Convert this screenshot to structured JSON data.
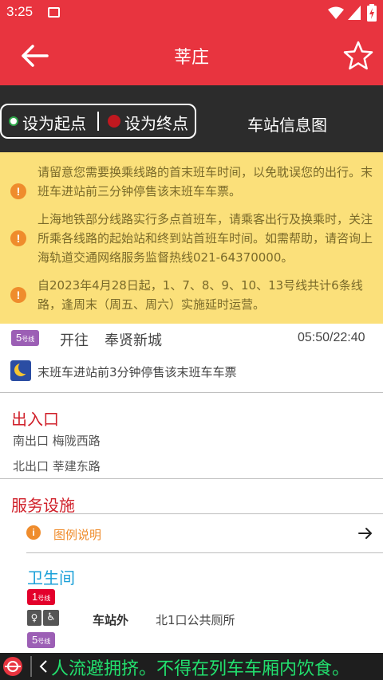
{
  "status": {
    "time": "3:25"
  },
  "header": {
    "title": "莘庄"
  },
  "actions": {
    "set_origin": "设为起点",
    "set_destination": "设为终点",
    "station_map": "车站信息图"
  },
  "notices": [
    {
      "text": "请留意您需要换乘线路的首末班车时间，以免耽误您的出行。末班车进站前三分钟停售该末班车车票。"
    },
    {
      "text": "上海地铁部分线路实行多点首班车，请乘客出行及换乘时，关注所乘各线路的起始站和终到站首班车时间。如需帮助，请咨询上海轨道交通网络服务监督热线021-64370000。"
    },
    {
      "text": "自2023年4月28日起，1、7、8、9、10、13号线共计6条线路，逢周末（周五、周六）实施延时运营。"
    }
  ],
  "line_info": {
    "badge_num": "5",
    "badge_suffix": "号线",
    "toward_label": "开往",
    "destination": "奉贤新城",
    "times": "05:50/22:40",
    "last_train_note": "末班车进站前3分钟停售该末班车车票"
  },
  "exits": {
    "title": "出入口",
    "items": [
      "南出口 梅陇西路",
      "北出口 莘建东路"
    ]
  },
  "services": {
    "title": "服务设施",
    "legend": "图例说明",
    "toilet_title": "卫生间",
    "toilet_line_num": "1",
    "toilet_line_suffix": "号线",
    "toilet_location": "车站外",
    "toilet_detail": "北1口公共厕所",
    "next_line_num": "5",
    "next_line_suffix": "号线"
  },
  "ticker": {
    "text": "人流避拥挤。不得在列车车厢内饮食。"
  },
  "colors": {
    "brand": "#e8343f",
    "line1": "#e3002b",
    "line5": "#9c5fb5",
    "notice_bg": "#fbe07a",
    "accent_blue": "#1aa0d8"
  }
}
